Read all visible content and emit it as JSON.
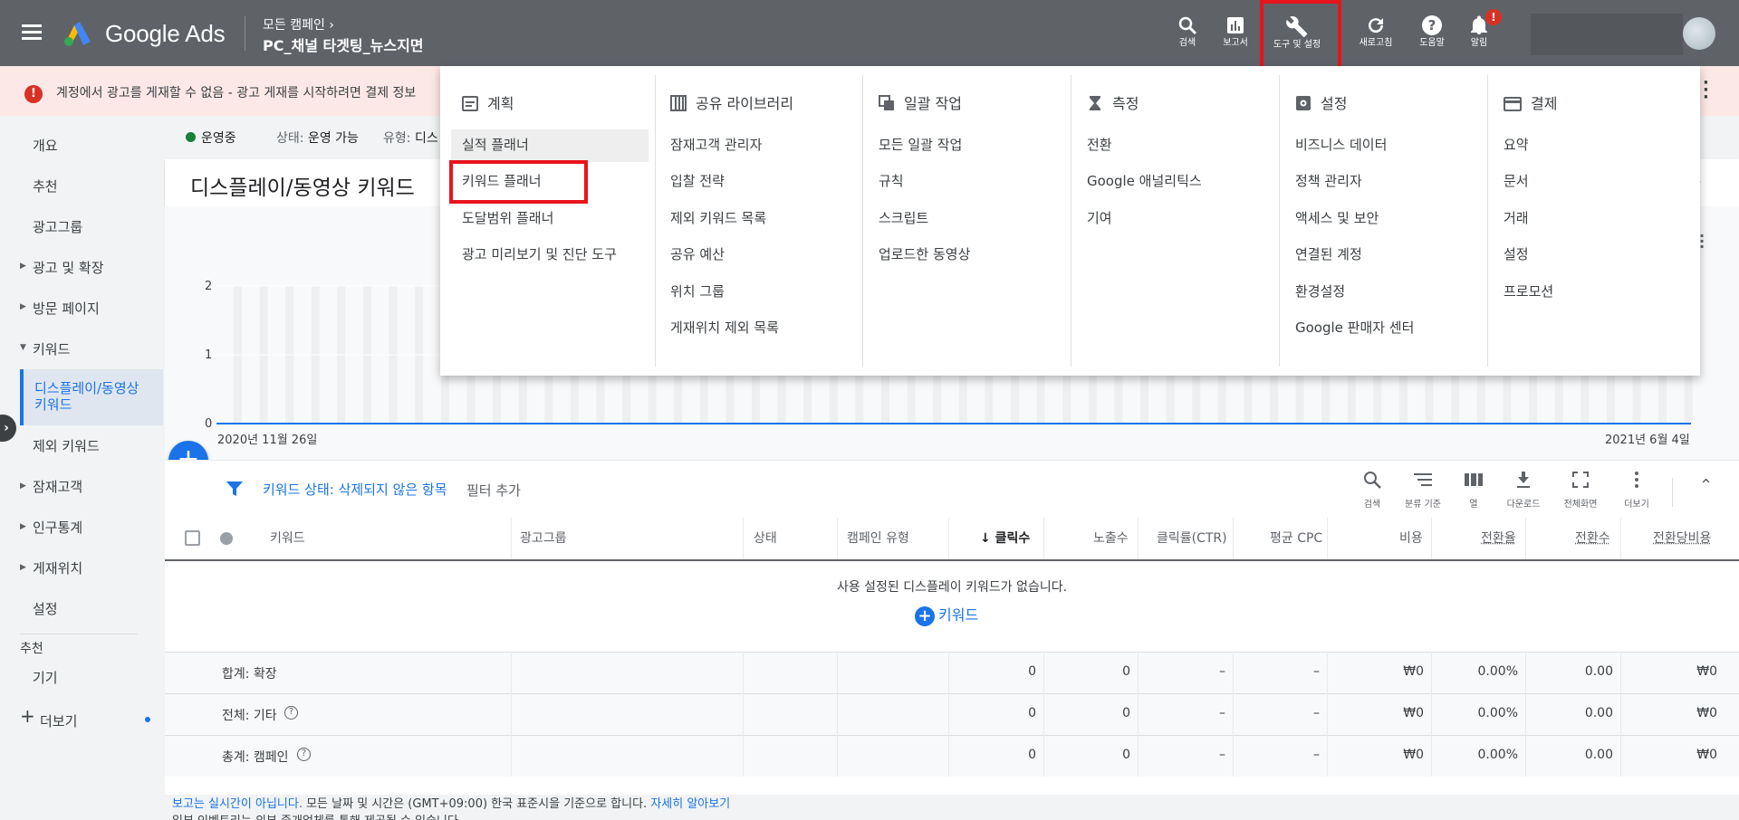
{
  "header": {
    "app_name": "Google Ads",
    "breadcrumb_parent": "모든 캠페인",
    "campaign_name": "PC_채널 타겟팅_뉴스지면",
    "buttons": {
      "search": "검색",
      "reports": "보고서",
      "tools": "도구 및 설정",
      "refresh": "새로고침",
      "help": "도움말",
      "notifications": "알림"
    },
    "notification_badge": "!"
  },
  "alert": {
    "icon": "!",
    "text": "계정에서 광고를 게재할 수 없음 - 광고 게재를 시작하려면 결제 정보"
  },
  "sidebar": {
    "overview": "개요",
    "recommendations": "추천",
    "ad_groups": "광고그룹",
    "ads_extensions": "광고 및 확장",
    "landing_pages": "방문 페이지",
    "keywords": "키워드",
    "display_keywords_line1": "디스플레이/동영상",
    "display_keywords_line2": "키워드",
    "negative_keywords": "제외 키워드",
    "audiences": "잠재고객",
    "demographics": "인구통계",
    "placements": "게재위치",
    "settings": "설정",
    "section_recommended": "추천",
    "devices": "기기",
    "more": "더보기"
  },
  "statusbar": {
    "status": "운영중",
    "state_label": "상태:",
    "state_value": "운영 가능",
    "type_label": "유형:",
    "type_value": "디스"
  },
  "page_title": "디스플레이/동영상 키워드",
  "chart": {
    "y_ticks": [
      "2",
      "1",
      "0"
    ],
    "start_date": "2020년 11월 26일",
    "end_date": "2021년 6월 4일"
  },
  "filterbar": {
    "filter_text": "키워드 상태: 삭제되지 않은 항목",
    "add_filter": "필터 추가",
    "tools": {
      "search": "검색",
      "segment": "분류 기준",
      "columns": "열",
      "download": "다운로드",
      "fullscreen": "전체화면",
      "more": "더보기"
    }
  },
  "table": {
    "headers": {
      "keyword": "키워드",
      "ad_group": "광고그룹",
      "status": "상태",
      "campaign_type": "캠페인 유형",
      "clicks": "클릭수",
      "impressions": "노출수",
      "ctr": "클릭률(CTR)",
      "avg_cpc": "평균 CPC",
      "cost": "비용",
      "conv_rate": "전환율",
      "conversions": "전환수",
      "cost_per_conv": "전환당비용"
    },
    "empty_message": "사용 설정된 디스플레이 키워드가 없습니다.",
    "add_keyword": "키워드",
    "summary_rows": [
      {
        "label": "합계: 확장",
        "clicks": "0",
        "impressions": "0",
        "ctr": "–",
        "avg_cpc": "–",
        "cost": "₩0",
        "conv_rate": "0.00%",
        "conversions": "0.00",
        "cost_per_conv": "₩0"
      },
      {
        "label": "전체: 기타",
        "clicks": "0",
        "impressions": "0",
        "ctr": "–",
        "avg_cpc": "–",
        "cost": "₩0",
        "conv_rate": "0.00%",
        "conversions": "0.00",
        "cost_per_conv": "₩0"
      },
      {
        "label": "총계: 캠페인",
        "clicks": "0",
        "impressions": "0",
        "ctr": "–",
        "avg_cpc": "–",
        "cost": "₩0",
        "conv_rate": "0.00%",
        "conversions": "0.00",
        "cost_per_conv": "₩0"
      }
    ]
  },
  "footer": {
    "link1": "보고는 실시간이 아닙니다.",
    "text1": " 모든 날짜 및 시간은 (GMT+09:00) 한국 표준시을 기준으로 합니다. ",
    "link2": "자세히 알아보기",
    "text2": "일부 인벤토리는 외부 중개업체를 통해 제공될 수 있습니다."
  },
  "menu": {
    "planning": {
      "title": "계획",
      "items": [
        "실적 플래너",
        "키워드 플래너",
        "도달범위 플래너",
        "광고 미리보기 및 진단 도구"
      ]
    },
    "shared_library": {
      "title": "공유 라이브러리",
      "items": [
        "잠재고객 관리자",
        "입찰 전략",
        "제외 키워드 목록",
        "공유 예산",
        "위치 그룹",
        "게재위치 제외 목록"
      ]
    },
    "bulk_actions": {
      "title": "일괄 작업",
      "items": [
        "모든 일괄 작업",
        "규칙",
        "스크립트",
        "업로드한 동영상"
      ]
    },
    "measurement": {
      "title": "측정",
      "items": [
        "전환",
        "Google 애널리틱스",
        "기여"
      ]
    },
    "setup": {
      "title": "설정",
      "items": [
        "비즈니스 데이터",
        "정책 관리자",
        "액세스 및 보안",
        "연결된 계정",
        "환경설정",
        "Google 판매자 센터"
      ]
    },
    "billing": {
      "title": "결제",
      "items": [
        "요약",
        "문서",
        "거래",
        "설정",
        "프로모션"
      ]
    }
  },
  "colors": {
    "header_bg": "#5f6368",
    "accent": "#1a73e8",
    "alert_bg": "#fce8e6",
    "highlight_box": "#e8141c",
    "status_green": "#188038"
  }
}
